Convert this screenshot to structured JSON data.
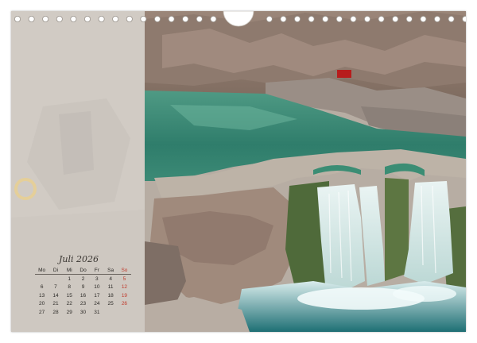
{
  "calendar": {
    "month_title": "Juli 2026",
    "weekdays": [
      "Mo",
      "Di",
      "Mi",
      "Do",
      "Fr",
      "Sa",
      "So"
    ],
    "weeks": [
      [
        "",
        "",
        "1",
        "2",
        "3",
        "4",
        "5"
      ],
      [
        "6",
        "7",
        "8",
        "9",
        "10",
        "11",
        "12"
      ],
      [
        "13",
        "14",
        "15",
        "16",
        "17",
        "18",
        "19"
      ],
      [
        "20",
        "21",
        "22",
        "23",
        "24",
        "25",
        "26"
      ],
      [
        "27",
        "28",
        "29",
        "30",
        "31",
        "",
        ""
      ]
    ],
    "sunday_color": "#c0392b"
  },
  "photo": {
    "subject": "waterfall-canyon-photo"
  }
}
